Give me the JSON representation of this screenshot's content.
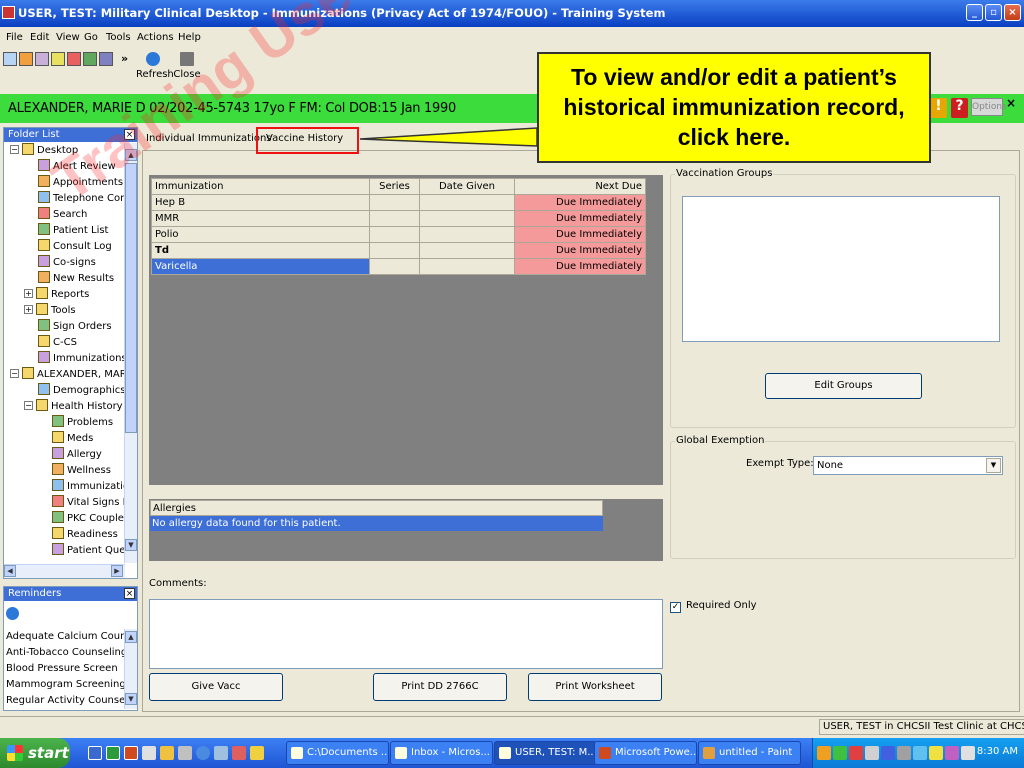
{
  "window": {
    "title": "USER, TEST: Military Clinical Desktop - Immunizations (Privacy Act of 1974/FOUO) -  Training System",
    "minimize": "_",
    "maximize": "▫",
    "close": "×"
  },
  "menu": [
    "File",
    "Edit",
    "View",
    "Go",
    "Tools",
    "Actions",
    "Help"
  ],
  "toolbar": {
    "refresh": "Refresh",
    "close": "Close",
    "chevron": "»"
  },
  "patient_banner": {
    "text": "ALEXANDER, MARIE D  02/202-45-5743  17yo  F   FM: Col  DOB:15 Jan 1990",
    "options": "Options"
  },
  "folder_list": {
    "title": "Folder List",
    "items": [
      {
        "label": "Desktop",
        "indent": 0,
        "expander": "−"
      },
      {
        "label": "Alert Review",
        "indent": 2
      },
      {
        "label": "Appointments",
        "indent": 2
      },
      {
        "label": "Telephone Consult",
        "indent": 2
      },
      {
        "label": "Search",
        "indent": 2
      },
      {
        "label": "Patient List",
        "indent": 2
      },
      {
        "label": "Consult Log",
        "indent": 2
      },
      {
        "label": "Co-signs",
        "indent": 2
      },
      {
        "label": "New Results",
        "indent": 2
      },
      {
        "label": "Reports",
        "indent": 1,
        "expander": "+"
      },
      {
        "label": "Tools",
        "indent": 1,
        "expander": "+"
      },
      {
        "label": "Sign Orders",
        "indent": 2
      },
      {
        "label": "C-CS",
        "indent": 2
      },
      {
        "label": "Immunizations Adm",
        "indent": 2
      },
      {
        "label": "ALEXANDER, MARIE",
        "indent": 0,
        "expander": "−"
      },
      {
        "label": "Demographics",
        "indent": 2
      },
      {
        "label": "Health History",
        "indent": 1,
        "expander": "−"
      },
      {
        "label": "Problems",
        "indent": 3
      },
      {
        "label": "Meds",
        "indent": 3
      },
      {
        "label": "Allergy",
        "indent": 3
      },
      {
        "label": "Wellness",
        "indent": 3
      },
      {
        "label": "Immunizations",
        "indent": 3
      },
      {
        "label": "Vital Signs Rev",
        "indent": 3
      },
      {
        "label": "PKC Couplers",
        "indent": 3
      },
      {
        "label": "Readiness",
        "indent": 3
      },
      {
        "label": "Patient Questio",
        "indent": 3
      }
    ]
  },
  "reminders": {
    "title": "Reminders",
    "items": [
      "Adequate Calcium Counseling",
      "Anti-Tobacco Counseling",
      "Blood Pressure Screen",
      "Mammogram Screening",
      "Regular Activity Counseling"
    ]
  },
  "tabs": {
    "individual": "Individual Immunizations",
    "history": "Vaccine History"
  },
  "immunization_table": {
    "headers": [
      "Immunization",
      "Series",
      "Date Given",
      "Next Due"
    ],
    "rows": [
      {
        "name": "Hep B",
        "series": "",
        "date": "",
        "due": "Due Immediately"
      },
      {
        "name": "MMR",
        "series": "",
        "date": "",
        "due": "Due Immediately"
      },
      {
        "name": "Polio",
        "series": "",
        "date": "",
        "due": "Due Immediately"
      },
      {
        "name": "Td",
        "series": "",
        "date": "",
        "due": "Due Immediately"
      },
      {
        "name": "Varicella",
        "series": "",
        "date": "",
        "due": "Due Immediately"
      }
    ]
  },
  "allergies": {
    "header": "Allergies",
    "row": "No allergy data found for this patient."
  },
  "comments_label": "Comments:",
  "buttons": {
    "give_vacc": "Give Vacc",
    "print_dd": "Print DD 2766C",
    "print_worksheet": "Print Worksheet",
    "edit_groups": "Edit Groups"
  },
  "vaccination_groups": {
    "label": "Vaccination Groups"
  },
  "global_exemption": {
    "label": "Global Exemption",
    "exempt_type_label": "Exempt Type:",
    "exempt_type_value": "None"
  },
  "required_only": {
    "label": "Required Only",
    "checked": true
  },
  "callout": {
    "text": "To view and/or edit a patient’s historical immunization record, click here."
  },
  "watermark": "Training Use Only",
  "status_bar": "USER, TEST in CHCSII Test Clinic at CHCSII T",
  "taskbar": {
    "start": "start",
    "tasks": [
      "C:\\Documents ...",
      "Inbox - Micros...",
      "USER, TEST: M...",
      "Microsoft Powe...",
      "untitled - Paint"
    ],
    "clock": "8:30 AM"
  },
  "colors": {
    "banner": "#3cdc3c",
    "due": "#f59a9a",
    "selection": "#3d6fd6",
    "callout": "#ffff00",
    "highlight": "#ee1111"
  }
}
